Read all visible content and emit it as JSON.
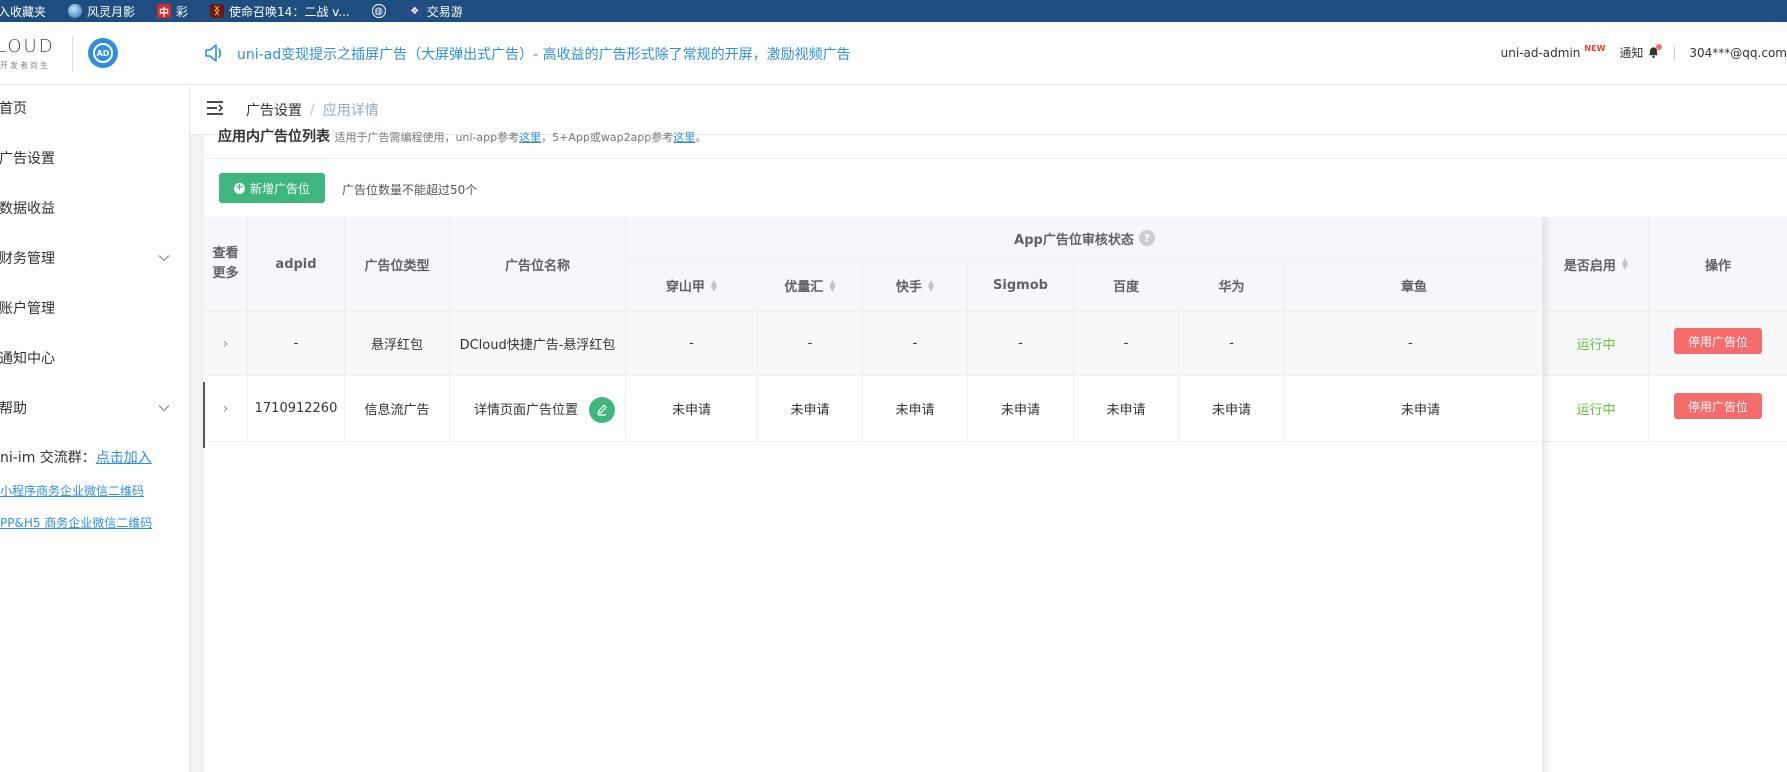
{
  "bookmarks": [
    {
      "label": "入收藏夹",
      "icon": "none"
    },
    {
      "label": "风灵月影",
      "icon": "globe-icon"
    },
    {
      "label": "彩",
      "icon": "zhong-icon",
      "glyph": "中"
    },
    {
      "label": "使命召唤14：二战 v...",
      "icon": "game-icon"
    },
    {
      "label": "",
      "icon": "globe-outline-icon"
    },
    {
      "label": "交易游",
      "icon": "jiaoyiyou-icon"
    }
  ],
  "header": {
    "logo_text": "LOUD",
    "logo_sub": "开发者尚生",
    "logo_badge": "AD",
    "notice": "uni-ad变现提示之插屏广告（大屏弹出式广告）- 高收益的广告形式除了常规的开屏，激励视频广告",
    "user": "uni-ad-admin",
    "new_badge": "NEW",
    "notify_label": "通知",
    "email": "304***@qq.com"
  },
  "sidebar": {
    "items": [
      {
        "label": "首页",
        "has_arrow": false
      },
      {
        "label": "广告设置",
        "has_arrow": false
      },
      {
        "label": "数据收益",
        "has_arrow": false
      },
      {
        "label": "财务管理",
        "has_arrow": true
      },
      {
        "label": "账户管理",
        "has_arrow": false
      },
      {
        "label": "通知中心",
        "has_arrow": false
      },
      {
        "label": "帮助",
        "has_arrow": true
      }
    ],
    "im_label": "ni-im 交流群：",
    "im_link": "点击加入",
    "links": [
      "小程序商务企业微信二维码",
      "PP&H5 商务企业微信二维码"
    ]
  },
  "breadcrumb": {
    "items": [
      "广告设置",
      "应用详情"
    ],
    "separator": "/"
  },
  "section": {
    "title": "应用内广告位列表",
    "desc_1": "适用于广告需编程使用，uni-app参考",
    "link_1": "这里",
    "desc_2": "，5+App或wap2app参考",
    "link_2": "这里",
    "desc_3": "。"
  },
  "toolbar": {
    "add_label": "新增广告位",
    "hint": "广告位数量不能超过50个"
  },
  "table": {
    "headers": {
      "more": "查看更多",
      "adpid": "adpid",
      "type": "广告位类型",
      "name": "广告位名称",
      "audit_group": "App广告位审核状态",
      "enabled": "是否启用",
      "actions": "操作"
    },
    "audit_columns": [
      {
        "label": "穿山甲",
        "sortable": true
      },
      {
        "label": "优量汇",
        "sortable": true
      },
      {
        "label": "快手",
        "sortable": true
      },
      {
        "label": "Sigmob",
        "sortable": false
      },
      {
        "label": "百度",
        "sortable": false
      },
      {
        "label": "华为",
        "sortable": false
      },
      {
        "label": "章鱼",
        "sortable": false
      }
    ],
    "rows": [
      {
        "adpid": "-",
        "type": "悬浮红包",
        "name": "DCloud快捷广告-悬浮红包",
        "audit": [
          "-",
          "-",
          "-",
          "-",
          "-",
          "-",
          "-"
        ],
        "status": "运行中",
        "action": "停用广告位",
        "editable": false
      },
      {
        "adpid": "1710912260",
        "type": "信息流广告",
        "name": "详情页面广告位置",
        "audit": [
          "未申请",
          "未申请",
          "未申请",
          "未申请",
          "未申请",
          "未申请",
          "未申请"
        ],
        "status": "运行中",
        "action": "停用广告位",
        "editable": true
      }
    ]
  },
  "colors": {
    "accent": "#2f8ee2",
    "primary_green": "#3fb67d",
    "danger": "#f56c6c",
    "running": "#67c23a",
    "topbar": "#1d4e7f"
  }
}
